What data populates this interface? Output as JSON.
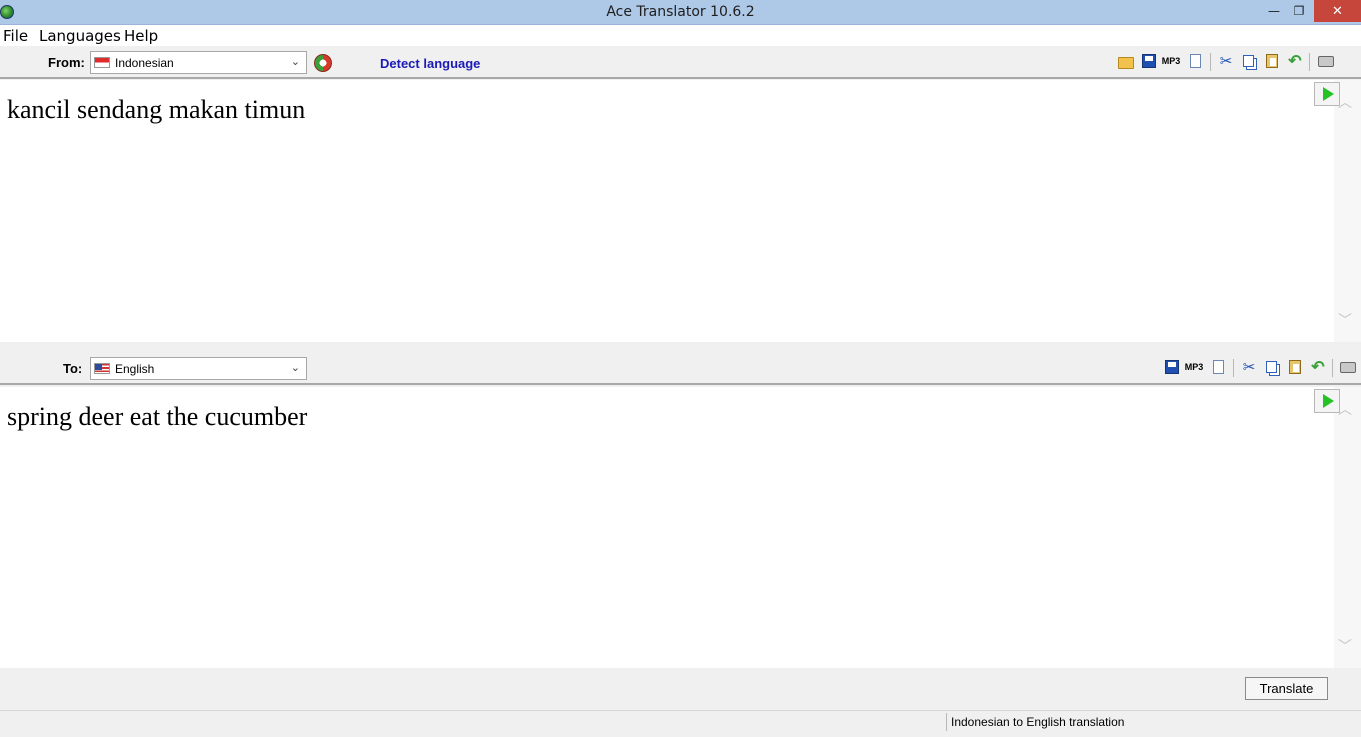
{
  "window": {
    "title": "Ace Translator 10.6.2",
    "app_icon": "globe-icon",
    "minimize_glyph": "—",
    "maximize_glyph": "❐",
    "close_glyph": "✕"
  },
  "menu": {
    "items": [
      "File",
      "Languages",
      "Help"
    ]
  },
  "source": {
    "label": "From:",
    "language": "Indonesian",
    "flag": "indonesia-flag-icon",
    "detect_label": "Detect language",
    "text": "kancil sendang makan timun"
  },
  "target": {
    "label": "To:",
    "language": "English",
    "flag": "usa-flag-icon",
    "text": "spring deer eat the cucumber"
  },
  "icons": {
    "mp3_label": "MP3",
    "cut_glyph": "✂",
    "undo_glyph": "↶",
    "dropdown_glyph": "⌄",
    "scroll_up_glyph": "︿",
    "scroll_down_glyph": "﹀"
  },
  "colors": {
    "titlebar": "#aec8e8",
    "close_button": "#c7463c",
    "detect_link": "#1a1ab8",
    "play_icon": "#25c225"
  },
  "footer": {
    "translate_label": "Translate",
    "status_text": "Indonesian to English translation"
  }
}
